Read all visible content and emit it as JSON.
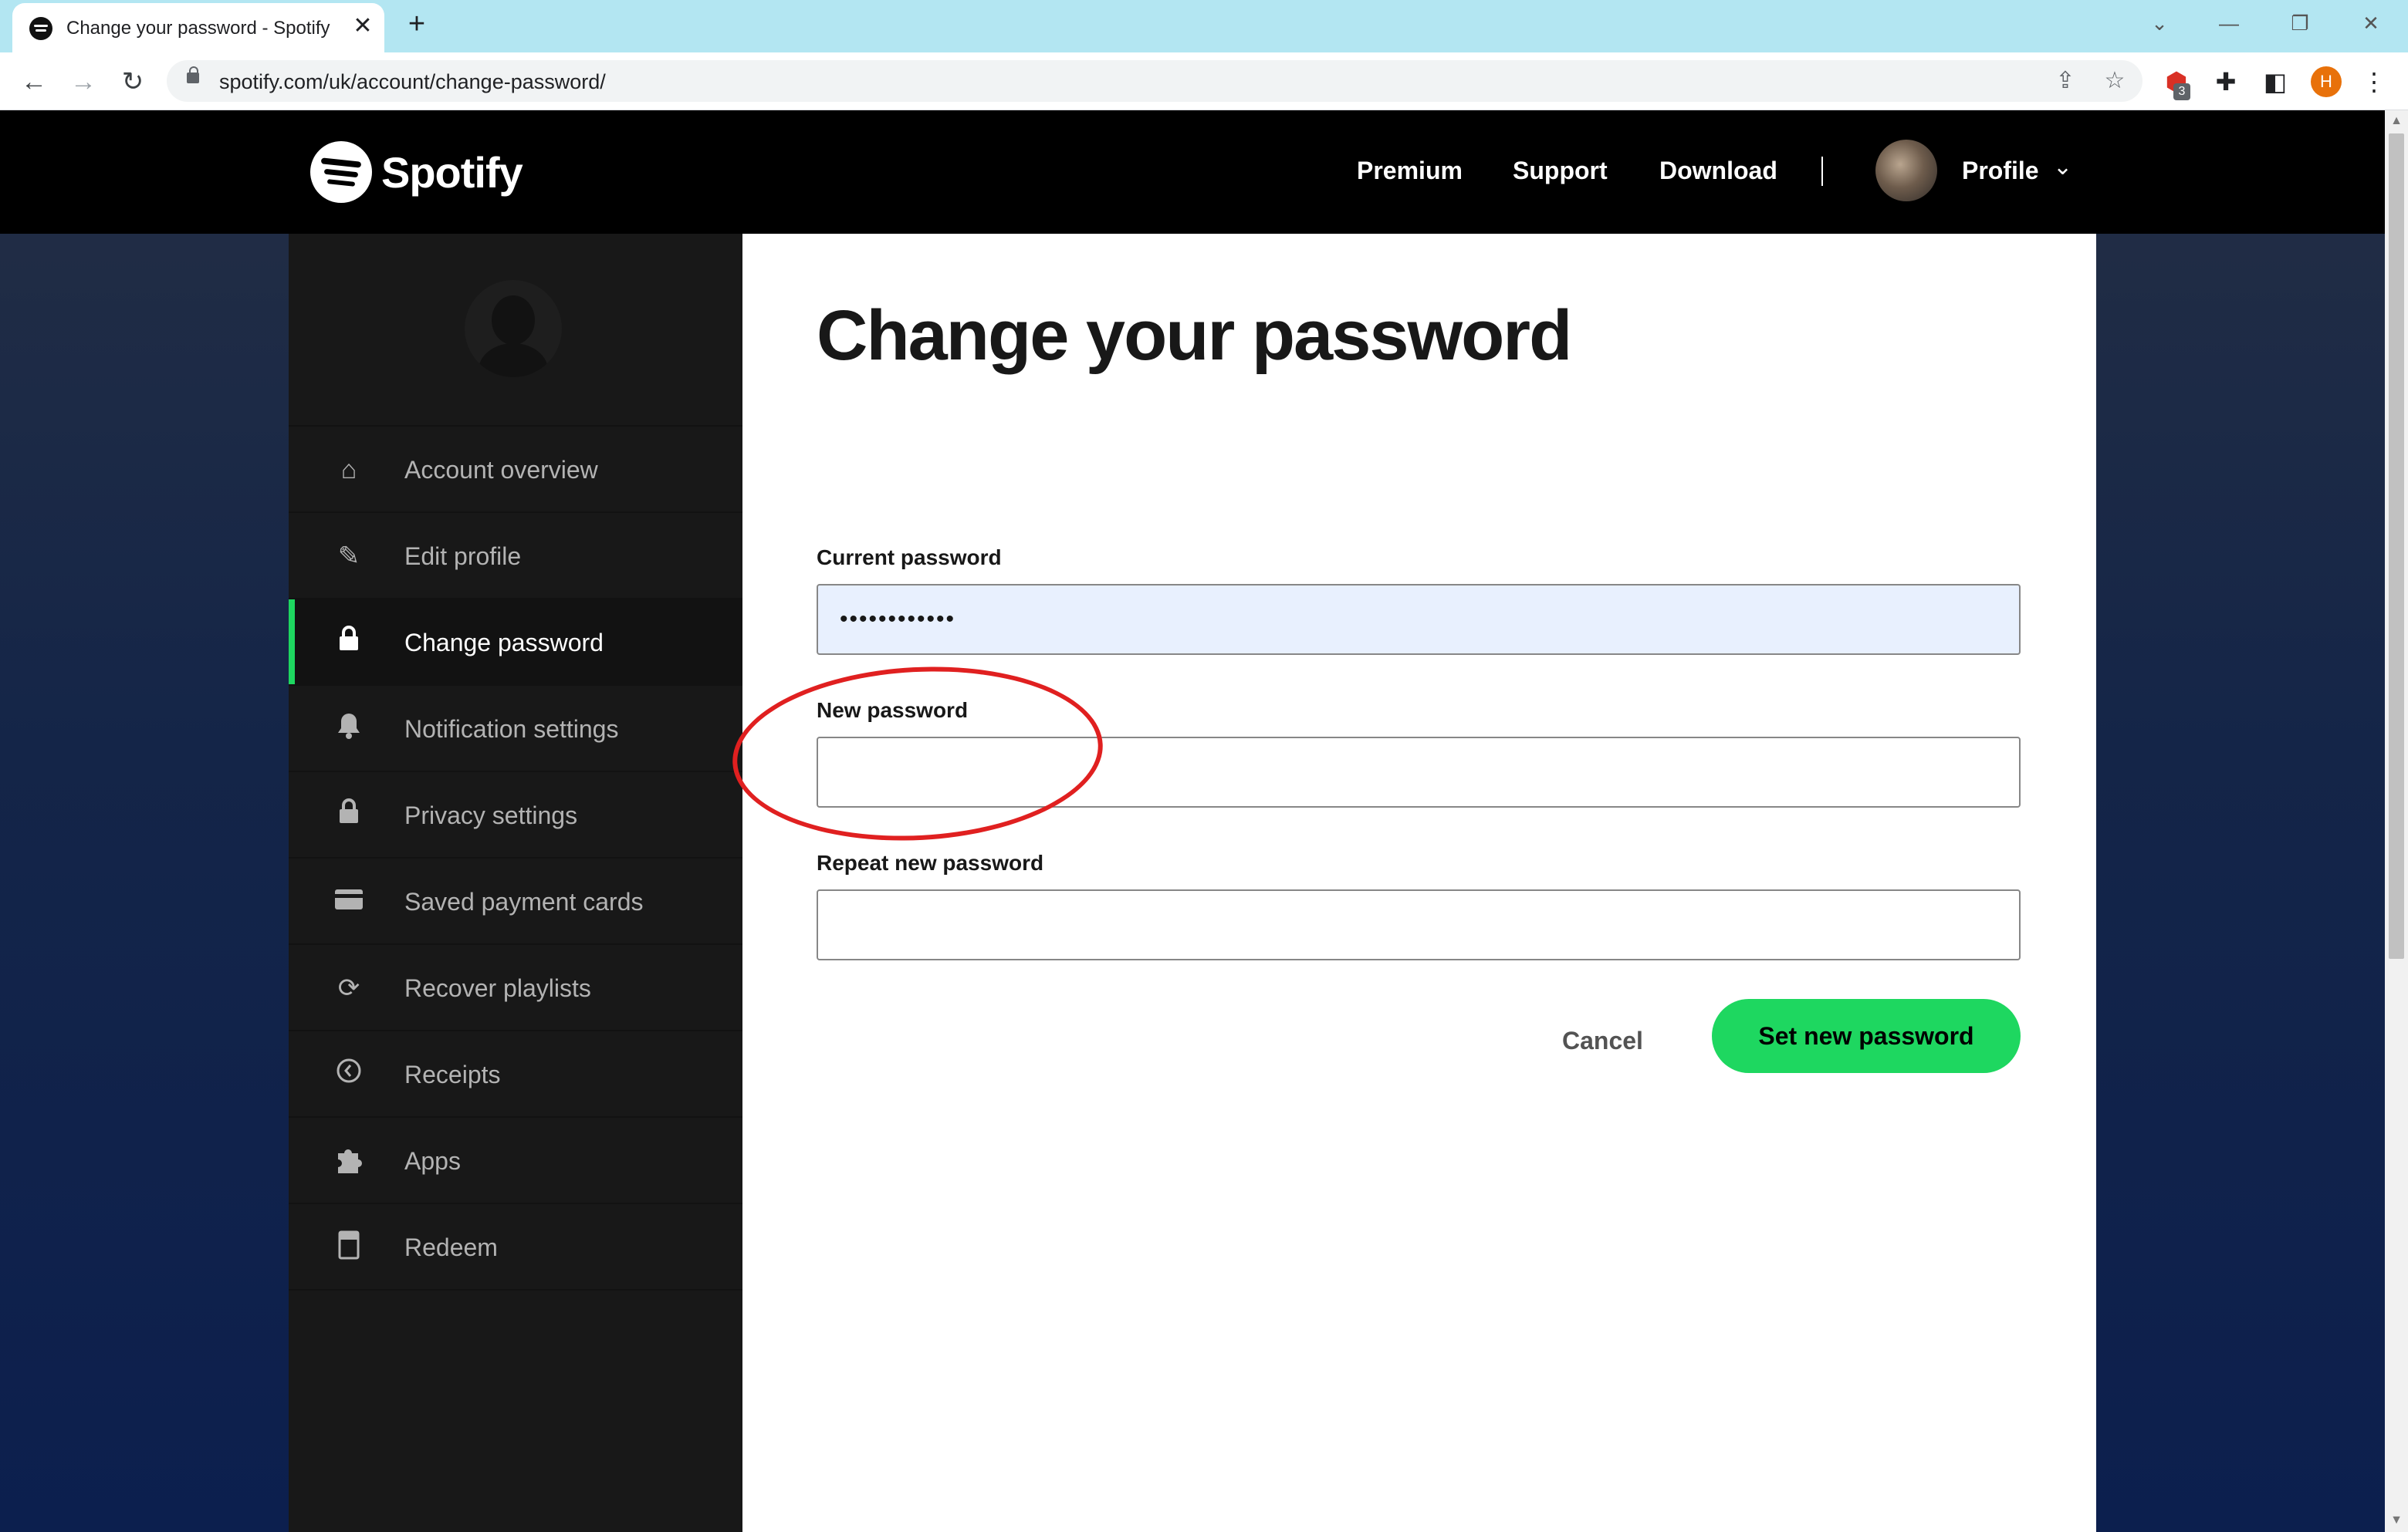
{
  "browser": {
    "tab_title": "Change your password - Spotify",
    "tab_close": "✕",
    "new_tab": "+",
    "url": "spotify.com/uk/account/change-password/",
    "extension_badge": "3",
    "profile_initial": "H",
    "window_controls": {
      "dropdown": "⌄",
      "minimize": "—",
      "restore": "❐",
      "close": "✕"
    }
  },
  "header": {
    "brand": "Spotify",
    "nav": [
      "Premium",
      "Support",
      "Download"
    ],
    "profile_label": "Profile",
    "profile_chevron": "⌄"
  },
  "sidebar": {
    "items": [
      {
        "label": "Account overview",
        "icon": "home-icon"
      },
      {
        "label": "Edit profile",
        "icon": "pencil-icon"
      },
      {
        "label": "Change password",
        "icon": "lock-icon",
        "active": true
      },
      {
        "label": "Notification settings",
        "icon": "bell-icon"
      },
      {
        "label": "Privacy settings",
        "icon": "lock-icon"
      },
      {
        "label": "Saved payment cards",
        "icon": "card-icon"
      },
      {
        "label": "Recover playlists",
        "icon": "refresh-icon"
      },
      {
        "label": "Receipts",
        "icon": "clock-icon"
      },
      {
        "label": "Apps",
        "icon": "puzzle-icon"
      },
      {
        "label": "Redeem",
        "icon": "gift-card-icon"
      }
    ]
  },
  "form": {
    "title": "Change your password",
    "current_password_label": "Current password",
    "current_password_value": "••••••••••••",
    "new_password_label": "New password",
    "new_password_value": "",
    "repeat_password_label": "Repeat new password",
    "repeat_password_value": "",
    "cancel_label": "Cancel",
    "submit_label": "Set new password"
  },
  "colors": {
    "accent": "#1ed760",
    "annotation": "#e02020",
    "autofill": "#e8f0fe"
  }
}
